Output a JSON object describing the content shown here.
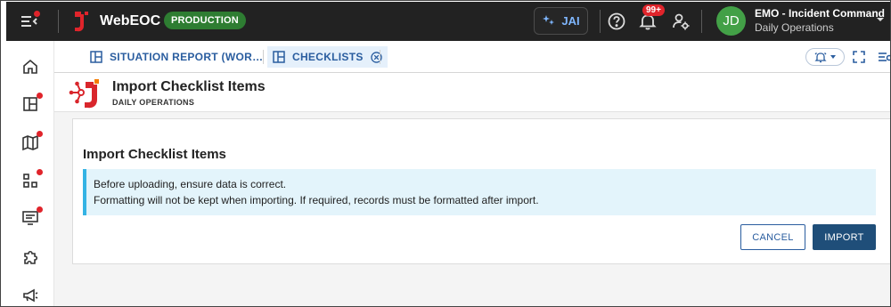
{
  "header": {
    "app_name": "WebEOC",
    "env_badge": "PRODUCTION",
    "ai_button_label": "JAI",
    "notifications_count": "99+",
    "user": {
      "initials": "JD",
      "name": "EMO - Incident Command",
      "position": "Daily Operations"
    }
  },
  "sidebar": {
    "items": [
      {
        "icon": "home-icon"
      },
      {
        "icon": "dashboard-icon",
        "has_alert": true
      },
      {
        "icon": "map-icon",
        "has_alert": true
      },
      {
        "icon": "boards-icon",
        "has_alert": true
      },
      {
        "icon": "display-icon",
        "has_alert": true
      },
      {
        "icon": "plugin-icon"
      },
      {
        "icon": "megaphone-icon"
      }
    ]
  },
  "tabs": [
    {
      "label": "SITUATION REPORT (WOR…",
      "active": false
    },
    {
      "label": "CHECKLISTS",
      "active": true
    }
  ],
  "page": {
    "title": "Import Checklist Items",
    "subtitle": "DAILY OPERATIONS"
  },
  "card": {
    "title": "Import Checklist Items",
    "alert_line1": "Before uploading, ensure data is correct.",
    "alert_line2": "Formatting will not be kept when importing. If required, records must be formatted after import.",
    "cancel_label": "CANCEL",
    "import_label": "IMPORT"
  },
  "colors": {
    "topbar": "#222222",
    "badge_green": "#2e7d32",
    "alert_bg": "#e3f4fb",
    "alert_border": "#34b3e4",
    "primary_button": "#1f4e79",
    "tab_blue": "#2a5d9f",
    "notification_red": "#e0242b"
  }
}
